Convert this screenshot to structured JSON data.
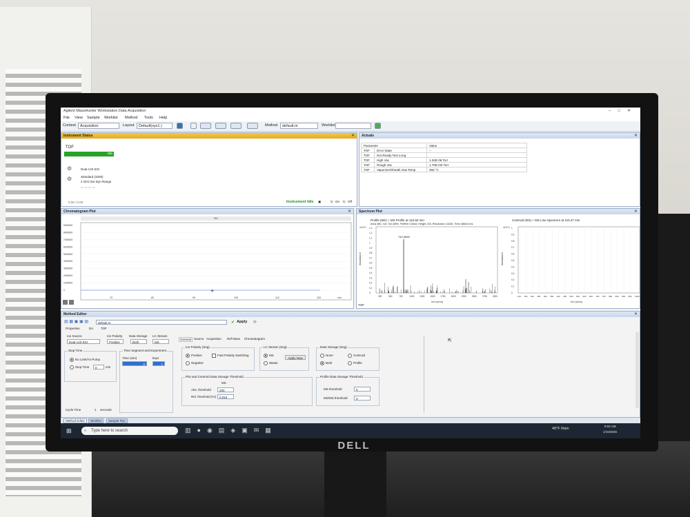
{
  "window": {
    "title": "Agilent MassHunter Workstation Data Acquisition"
  },
  "menu": [
    "File",
    "View",
    "Sample",
    "Worklist",
    "Method",
    "Tools",
    "Help"
  ],
  "toolbar": {
    "context_label": "Context",
    "context_value": "Acquisition",
    "layout_label": "Layout",
    "layout_value": "Default(sys1.)",
    "method_label": "Method",
    "method_value": "default.m",
    "worklist_label": "Worklist",
    "worklist_value": ""
  },
  "instrument_status": {
    "title": "Instrument Status",
    "device": "TOF",
    "state": "Idle",
    "source": "Dual AJS ESI",
    "standard": "Standard (3200)",
    "range": "2 GHz Ext Dyn Range",
    "time": "0.00 / 0.00",
    "status_text": "Instrument Idle",
    "on_label": "On",
    "off_label": "Off"
  },
  "actuals": {
    "title": "Actuals",
    "headers": [
      "Parameter",
      "Value"
    ],
    "rows": [
      [
        "TOF",
        "Error State",
        "--"
      ],
      [
        "TOF",
        "Not Ready Text Long",
        ""
      ],
      [
        "TOF",
        "High Vac",
        "1.04E-06 Torr"
      ],
      [
        "TOF",
        "Rough Vac",
        "1.70E+00 Torr"
      ],
      [
        "TOF",
        "Vaporizer/Sheath Gas Temp",
        "350 °C"
      ]
    ]
  },
  "chromatogram": {
    "title": "Chromatogram Plot",
    "trace": "TIC",
    "y_ticks": [
      "9000000",
      "8000000",
      "7000000",
      "6000000",
      "5000000",
      "4000000",
      "3000000",
      "2000000",
      "1000000",
      "0"
    ],
    "x_ticks": [
      "70",
      "80",
      "90",
      "100",
      "110",
      "120"
    ],
    "x_unit": "min"
  },
  "spectrum": {
    "title": "Spectrum Plot",
    "profile_title": "Profile (MS) + MS Profile at 115.50 min",
    "profile_info": "Area 480, m/z 742.4699, FWHM 0.0818, Height 133, Resolution 14426, Time 48644.0ns",
    "peak_label": "742.4699",
    "profile_x": [
      "250",
      "500",
      "750",
      "1000",
      "1250",
      "1500",
      "1750",
      "2000",
      "2250",
      "2500",
      "2750",
      "3000"
    ],
    "centroid_title": "Centroid (MS) + MS Line Spectrum at 115.27 min",
    "centroid_x": [
      "100",
      "150",
      "200",
      "250",
      "300",
      "350",
      "400",
      "450",
      "500",
      "550",
      "600",
      "650",
      "700",
      "750",
      "800",
      "850",
      "900",
      "950",
      "1000"
    ],
    "y_label": "Abundance",
    "x_label": "m/z (amu)",
    "exp_label": "x10^2",
    "profile_y": [
      "1.3",
      "1.2",
      "1.1",
      "1",
      "0.9",
      "0.8",
      "0.7",
      "0.6",
      "0.5",
      "0.4",
      "0.3",
      "0.2",
      "0.1",
      "0"
    ],
    "centroid_y": [
      "1",
      "0.9",
      "0.8",
      "0.7",
      "0.6",
      "0.5",
      "0.4",
      "0.3",
      "0.2",
      "0.1",
      "0"
    ],
    "footer": "TOF"
  },
  "method_editor": {
    "title": "Method Editor",
    "file": "default.m",
    "apply": "Apply",
    "subtabs": [
      "Properties",
      "DA",
      "TOF"
    ],
    "ion_source": "Ion Source",
    "ion_source_value": "Dual AJS ESI",
    "ion_polarity": "Ion Polarity",
    "ion_polarity_value": "Positive",
    "data_storage": "Data Storage",
    "data_storage_value": "Both",
    "lc_stream": "LC Stream",
    "lc_stream_value": "MS",
    "tabs": [
      "General",
      "Source",
      "Acquisition",
      "Ref Mass",
      "Chromatogram"
    ],
    "stop_time": "Stop Time",
    "no_limit": "No Limit/As Pump",
    "stop_time_opt": "Stop Time",
    "stop_val": "0",
    "min": "min",
    "time_segment": "Time Segment and Experiment",
    "time_col": "Time (min)",
    "time_val": "0",
    "expt_col": "Expt",
    "expt_val": "1",
    "ion_polarity_seg": "Ion Polarity (Seg)",
    "positive": "Positive",
    "negative": "Negative",
    "fast_switching": "Fast Polarity Switching",
    "lc_stream_seg": "LC Stream (Seg)",
    "ms": "MS",
    "waste": "Waste",
    "apply_now": "Apply Now",
    "data_storage_seg": "Data Storage (Seg)",
    "none": "None",
    "centroid": "Centroid",
    "both": "Both",
    "profile": "Profile",
    "plot_threshold": "Plot and Centroid Data Storage Threshold",
    "ms_col": "MS",
    "abs_threshold": "Abs. threshold",
    "abs_val": "200",
    "rel_threshold": "Rel. threshold (%)",
    "rel_val": "0.010",
    "profile_threshold": "Profile Data Storage Threshold",
    "ms_threshold": "MS threshold",
    "ms_threshold_val": "0",
    "msms_threshold": "MS/MS threshold",
    "msms_threshold_val": "0",
    "cycle_time": "Cycle Time",
    "cycle_val": "1",
    "seconds": "seconds"
  },
  "bottom_tabs": [
    "Method Editor",
    "Worklist",
    "Sample Run"
  ],
  "taskbar": {
    "search_placeholder": "Type here to search",
    "weather": "40°F Rain",
    "time": "8:02 AM",
    "date": "1/16/2026"
  },
  "monitor_brand": "DELL"
}
